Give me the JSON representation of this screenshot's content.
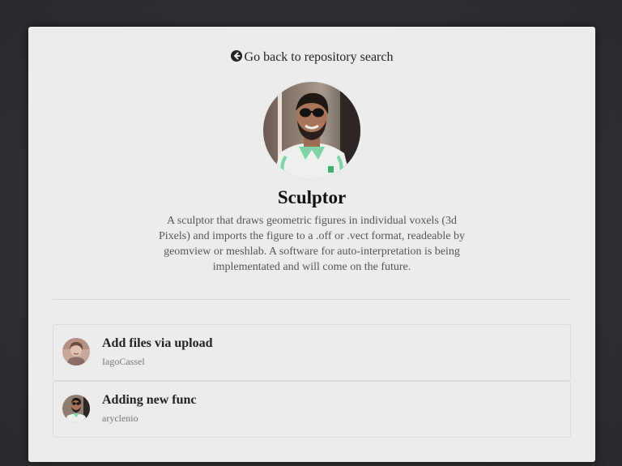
{
  "nav": {
    "back_label": "Go back to repository search",
    "back_icon": "arrow-circle-left-icon"
  },
  "repo": {
    "name": "Sculptor",
    "description": "A sculptor that draws geometric figures in individual voxels (3d Pixels) and imports the figure to a .off or .vect format, readeable by geomview or meshlab. A software for auto-interpretation is being implementated and will come on the future."
  },
  "commits": [
    {
      "message": "Add files via upload",
      "author": "IagoCassel"
    },
    {
      "message": "Adding new func",
      "author": "aryclenio"
    }
  ],
  "colors": {
    "background": "#2c2d30",
    "card": "#ececec",
    "text": "#222222",
    "muted": "#777777"
  }
}
